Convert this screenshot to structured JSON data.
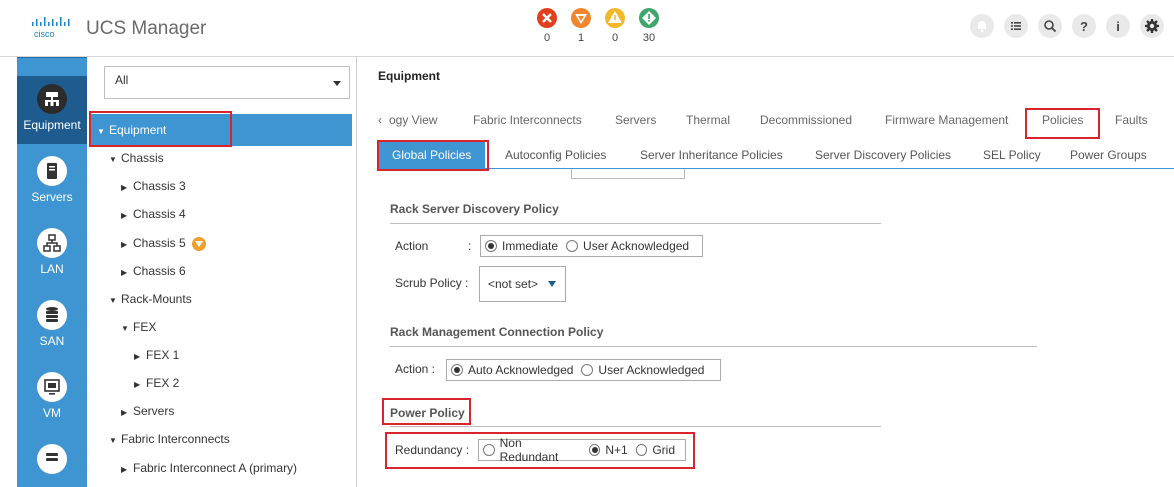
{
  "header": {
    "app_title": "UCS Manager",
    "logo_text": "cisco",
    "faults": [
      {
        "severity": "critical",
        "count": "0",
        "color": "#e2401c"
      },
      {
        "severity": "major",
        "count": "1",
        "color": "#f0862d"
      },
      {
        "severity": "minor",
        "count": "0",
        "color": "#f2b829"
      },
      {
        "severity": "warning",
        "count": "30",
        "color": "#3ea66a"
      }
    ],
    "icons": [
      "bell-icon",
      "list-icon",
      "search-icon",
      "help-icon",
      "info-icon",
      "settings-icon"
    ]
  },
  "leftnav": {
    "items": [
      {
        "label": "Equipment",
        "icon": "equipment-icon"
      },
      {
        "label": "Servers",
        "icon": "server-icon"
      },
      {
        "label": "LAN",
        "icon": "lan-icon"
      },
      {
        "label": "SAN",
        "icon": "san-icon"
      },
      {
        "label": "VM",
        "icon": "vm-icon"
      }
    ]
  },
  "tree": {
    "filter_value": "All",
    "rows": [
      {
        "label": "Equipment"
      },
      {
        "label": "Chassis"
      },
      {
        "label": "Chassis 3"
      },
      {
        "label": "Chassis 4"
      },
      {
        "label": "Chassis 5"
      },
      {
        "label": "Chassis 6"
      },
      {
        "label": "Rack-Mounts"
      },
      {
        "label": "FEX"
      },
      {
        "label": "FEX 1"
      },
      {
        "label": "FEX 2"
      },
      {
        "label": "Servers"
      },
      {
        "label": "Fabric Interconnects"
      },
      {
        "label": "Fabric Interconnect A (primary)"
      }
    ]
  },
  "content": {
    "title": "Equipment",
    "tabs": [
      "ogy View",
      "Fabric Interconnects",
      "Servers",
      "Thermal",
      "Decommissioned",
      "Firmware Management",
      "Policies",
      "Faults"
    ],
    "subtabs": [
      "Global Policies",
      "Autoconfig Policies",
      "Server Inheritance Policies",
      "Server Discovery Policies",
      "SEL Policy",
      "Power Groups"
    ],
    "rack_discovery": {
      "title": "Rack Server Discovery Policy",
      "action_label": "Action",
      "action_colon": ":",
      "action_options": [
        "Immediate",
        "User Acknowledged"
      ],
      "scrub_label": "Scrub Policy :",
      "scrub_value": "<not set>"
    },
    "rack_mgmt": {
      "title": "Rack Management Connection Policy",
      "action_label": "Action :",
      "action_options": [
        "Auto Acknowledged",
        "User Acknowledged"
      ]
    },
    "power": {
      "title": "Power Policy",
      "redundancy_label": "Redundancy :",
      "options": [
        "Non Redundant",
        "N+1",
        "Grid"
      ]
    }
  }
}
